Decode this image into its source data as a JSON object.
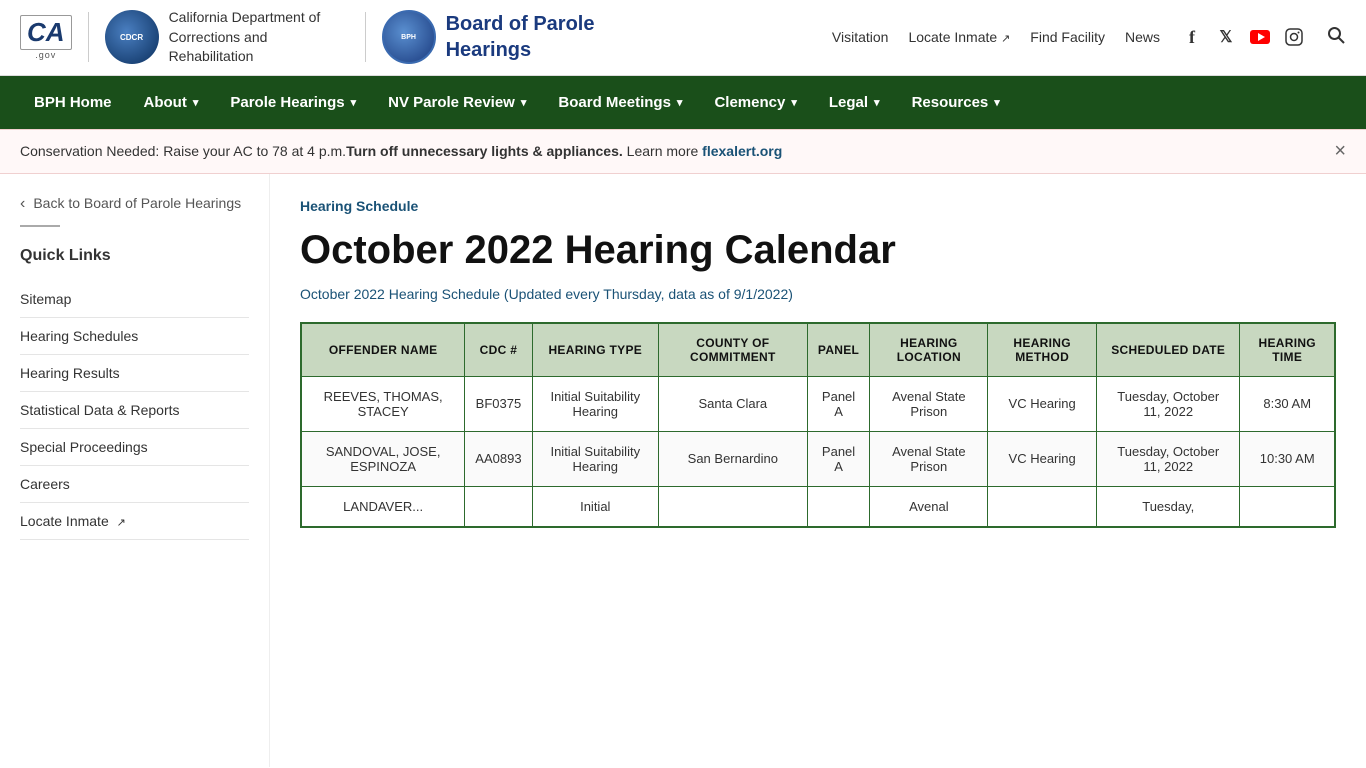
{
  "header": {
    "ca_logo": "CA",
    "ca_gov_label": ".gov",
    "org_name": "California Department of\nCorrections and Rehabilitation",
    "bph_name_line1": "Board of Parole",
    "bph_name_line2": "Hearings",
    "top_nav": [
      {
        "id": "visitation",
        "label": "Visitation"
      },
      {
        "id": "locate-inmate",
        "label": "Locate Inmate",
        "external": true
      },
      {
        "id": "find-facility",
        "label": "Find Facility"
      },
      {
        "id": "news",
        "label": "News"
      }
    ],
    "social": [
      {
        "id": "facebook",
        "icon": "f"
      },
      {
        "id": "twitter",
        "icon": "𝕏"
      },
      {
        "id": "youtube",
        "icon": "▶"
      },
      {
        "id": "instagram",
        "icon": "⬡"
      }
    ]
  },
  "main_nav": [
    {
      "id": "bph-home",
      "label": "BPH Home",
      "hasDropdown": false
    },
    {
      "id": "about",
      "label": "About",
      "hasDropdown": true
    },
    {
      "id": "parole-hearings",
      "label": "Parole Hearings",
      "hasDropdown": true
    },
    {
      "id": "nv-parole-review",
      "label": "NV Parole Review",
      "hasDropdown": true
    },
    {
      "id": "board-meetings",
      "label": "Board Meetings",
      "hasDropdown": true
    },
    {
      "id": "clemency",
      "label": "Clemency",
      "hasDropdown": true
    },
    {
      "id": "legal",
      "label": "Legal",
      "hasDropdown": true
    },
    {
      "id": "resources",
      "label": "Resources",
      "hasDropdown": true
    }
  ],
  "alert": {
    "text_pre": "Conservation Needed: Raise your AC to 78 at 4 p.m.",
    "text_bold": "Turn off unnecessary lights & appliances.",
    "text_after": " Learn more",
    "link_text": "flexalert.org",
    "link_url": "https://www.flexalert.org"
  },
  "sidebar": {
    "back_link": "Back to Board of Parole Hearings",
    "section_title": "Quick Links",
    "links": [
      {
        "id": "sitemap",
        "label": "Sitemap",
        "external": false
      },
      {
        "id": "hearing-schedules",
        "label": "Hearing Schedules",
        "external": false
      },
      {
        "id": "hearing-results",
        "label": "Hearing Results",
        "external": false
      },
      {
        "id": "statistical-data",
        "label": "Statistical Data & Reports",
        "external": false
      },
      {
        "id": "special-proceedings",
        "label": "Special Proceedings",
        "external": false
      },
      {
        "id": "careers",
        "label": "Careers",
        "external": false
      },
      {
        "id": "locate-inmate",
        "label": "Locate Inmate",
        "external": true
      }
    ]
  },
  "content": {
    "breadcrumb": "Hearing Schedule",
    "page_title": "October 2022 Hearing Calendar",
    "subtitle": "October 2022 Hearing Schedule (Updated every Thursday, data as of 9/1/2022)",
    "table": {
      "headers": [
        "OFFENDER NAME",
        "CDC #",
        "HEARING TYPE",
        "COUNTY OF COMMITMENT",
        "PANEL",
        "HEARING LOCATION",
        "HEARING METHOD",
        "SCHEDULED DATE",
        "HEARING TIME"
      ],
      "rows": [
        {
          "name": "REEVES, THOMAS, STACEY",
          "cdc": "BF0375",
          "hearing_type": "Initial Suitability Hearing",
          "county": "Santa Clara",
          "panel": "Panel A",
          "location": "Avenal State Prison",
          "method": "VC Hearing",
          "date": "Tuesday, October 11, 2022",
          "time": "8:30 AM"
        },
        {
          "name": "SANDOVAL, JOSE, ESPINOZA",
          "cdc": "AA0893",
          "hearing_type": "Initial Suitability Hearing",
          "county": "San Bernardino",
          "panel": "Panel A",
          "location": "Avenal State Prison",
          "method": "VC Hearing",
          "date": "Tuesday, October 11, 2022",
          "time": "10:30 AM"
        },
        {
          "name": "LANDAVER...",
          "cdc": "",
          "hearing_type": "Initial",
          "county": "",
          "panel": "",
          "location": "Avenal",
          "method": "",
          "date": "Tuesday,",
          "time": ""
        }
      ]
    }
  }
}
